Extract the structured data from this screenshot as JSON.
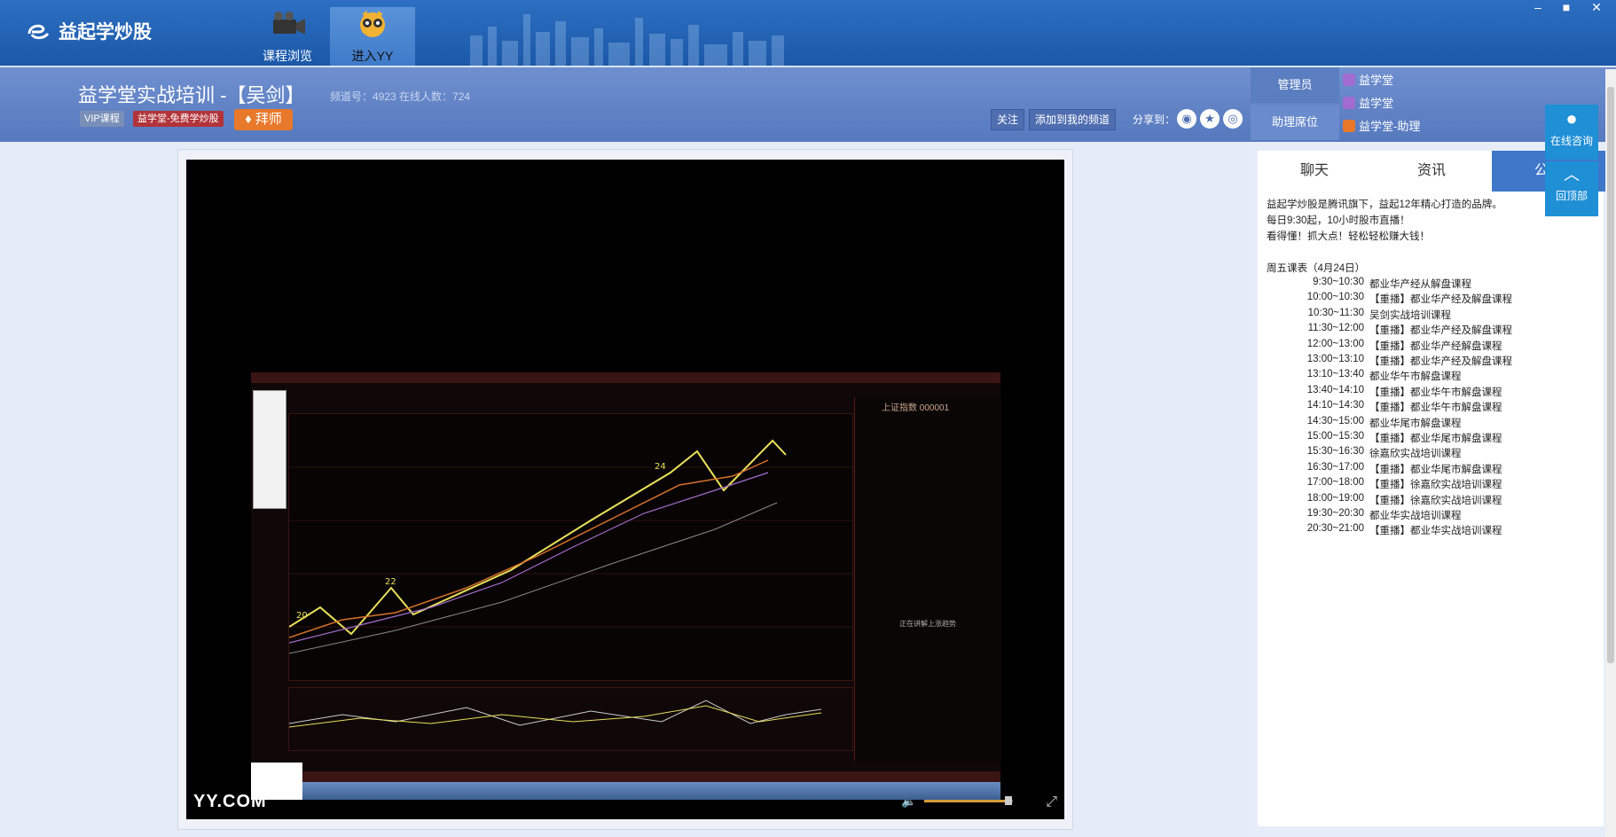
{
  "app": {
    "name": "益起学炒股"
  },
  "nav": [
    {
      "label": "课程浏览",
      "icon": "video-camera-icon"
    },
    {
      "label": "进入YY",
      "icon": "yy-raccoon-icon",
      "active": true
    }
  ],
  "window_controls": [
    "–",
    "■",
    "✕"
  ],
  "room": {
    "title": "益学堂实战培训 -【吴剑】",
    "info": "频道号：4923    在线人数：724",
    "badges": [
      "VIP课程",
      "益学堂-免费学炒股"
    ],
    "master_btn": "拜师",
    "buttons": [
      "关注",
      "添加到我的频道"
    ],
    "share_label": "分享到："
  },
  "admin": {
    "labels": [
      "管理员",
      "助理席位"
    ],
    "users": [
      "益学堂",
      "益学堂",
      "益学堂-助理"
    ]
  },
  "tabs": [
    "聊天",
    "资讯",
    "公告"
  ],
  "announcement": {
    "intro": [
      "益起学炒股是腾讯旗下，益起12年精心打造的品牌。",
      "每日9:30起，10小时股市直播！",
      "看得懂！抓大点！轻松轻松赚大钱！"
    ],
    "schedule_title": "周五课表（4月24日）",
    "schedule": [
      {
        "time": "9:30~10:30",
        "title": "都业华产经从解盘课程"
      },
      {
        "time": "10:00~10:30",
        "title": "【重播】都业华产经及解盘课程"
      },
      {
        "time": "10:30~11:30",
        "title": "吴剑实战培训课程"
      },
      {
        "time": "11:30~12:00",
        "title": "【重播】都业华产经及解盘课程"
      },
      {
        "time": "12:00~13:00",
        "title": "【重播】都业华产经解盘课程"
      },
      {
        "time": "13:00~13:10",
        "title": "【重播】都业华产经及解盘课程"
      },
      {
        "time": "13:10~13:40",
        "title": "都业华午市解盘课程"
      },
      {
        "time": "13:40~14:10",
        "title": "【重播】都业华午市解盘课程"
      },
      {
        "time": "14:10~14:30",
        "title": "【重播】都业华午市解盘课程"
      },
      {
        "time": "14:30~15:00",
        "title": "都业华尾市解盘课程"
      },
      {
        "time": "15:00~15:30",
        "title": "【重播】都业华尾市解盘课程"
      },
      {
        "time": "15:30~16:30",
        "title": "徐嘉欣实战培训课程"
      },
      {
        "time": "16:30~17:00",
        "title": "【重播】都业华尾市解盘课程"
      },
      {
        "time": "17:00~18:00",
        "title": "【重播】徐嘉欣实战培训课程"
      },
      {
        "time": "18:00~19:00",
        "title": "【重播】徐嘉欣实战培训课程"
      },
      {
        "time": "19:30~20:30",
        "title": "都业华实战培训课程"
      },
      {
        "time": "20:30~21:00",
        "title": "【重播】都业华实战培训课程"
      }
    ]
  },
  "float_buttons": [
    "在线咨询",
    "回顶部"
  ],
  "video": {
    "logo": "YY.COM",
    "volume": 0.95,
    "screen_index": "上证指数 000001",
    "screen_note": "正在讲解上涨趋势"
  }
}
